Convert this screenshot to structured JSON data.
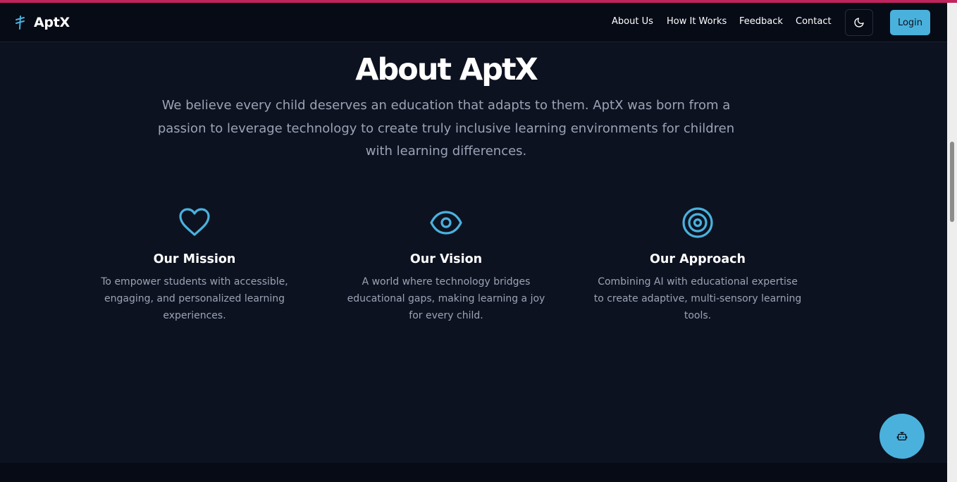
{
  "brand": {
    "name": "AptX",
    "icon": "aptx-logo-icon"
  },
  "nav": {
    "links": [
      "About Us",
      "How It Works",
      "Feedback",
      "Contact"
    ],
    "theme_toggle_icon": "moon-icon",
    "login_label": "Login"
  },
  "hero": {
    "title": "About AptX",
    "description": "We believe every child deserves an education that adapts to them. AptX was born from a passion to leverage technology to create truly inclusive learning environments for children with learning differences."
  },
  "cards": [
    {
      "icon": "heart-icon",
      "title": "Our Mission",
      "text": "To empower students with accessible, engaging, and personalized learning experiences."
    },
    {
      "icon": "eye-icon",
      "title": "Our Vision",
      "text": "A world where technology bridges educational gaps, making learning a joy for every child."
    },
    {
      "icon": "target-icon",
      "title": "Our Approach",
      "text": "Combining AI with educational expertise to create adaptive, multi-sensory learning tools."
    }
  ],
  "chat": {
    "icon": "bot-icon"
  },
  "colors": {
    "accent": "#4ab1dd",
    "background": "#0d1220",
    "navbar": "#070b16",
    "top_border": "#c0245c",
    "muted_text": "#9aa3b5"
  }
}
